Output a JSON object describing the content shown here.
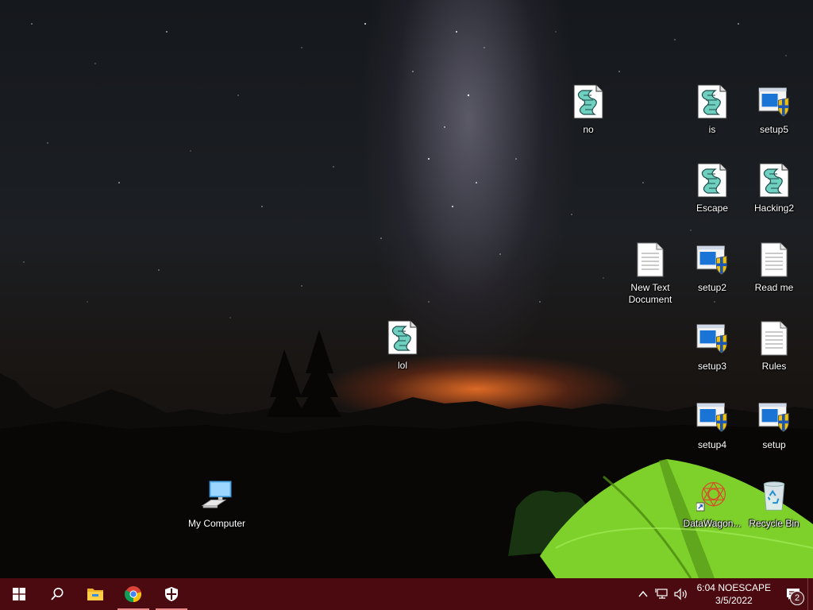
{
  "desktop": {
    "icons": [
      {
        "label": "no",
        "type": "script"
      },
      {
        "label": "is",
        "type": "script"
      },
      {
        "label": "setup5",
        "type": "installer"
      },
      {
        "label": "Escape",
        "type": "script"
      },
      {
        "label": "Hacking2",
        "type": "script"
      },
      {
        "label": "New Text Document",
        "type": "text"
      },
      {
        "label": "setup2",
        "type": "installer"
      },
      {
        "label": "Read me",
        "type": "text"
      },
      {
        "label": "lol",
        "type": "script"
      },
      {
        "label": "setup3",
        "type": "installer"
      },
      {
        "label": "Rules",
        "type": "text"
      },
      {
        "label": "setup4",
        "type": "installer"
      },
      {
        "label": "setup",
        "type": "installer"
      },
      {
        "label": "My Computer",
        "type": "computer"
      },
      {
        "label": "DataWagon...",
        "type": "shortcut"
      },
      {
        "label": "Recycle Bin",
        "type": "recycle-bin"
      }
    ]
  },
  "taskbar": {
    "pinned": [
      "start-icon",
      "search-icon",
      "file-explorer-icon",
      "chrome-icon",
      "security-shield-icon"
    ],
    "clock": {
      "time": "6:04 NOESCAPE",
      "date": "3/5/2022"
    },
    "notifications": {
      "count": "2"
    },
    "colors": {
      "taskbar": "#4a0a10",
      "accent": "#e88a8a"
    }
  }
}
